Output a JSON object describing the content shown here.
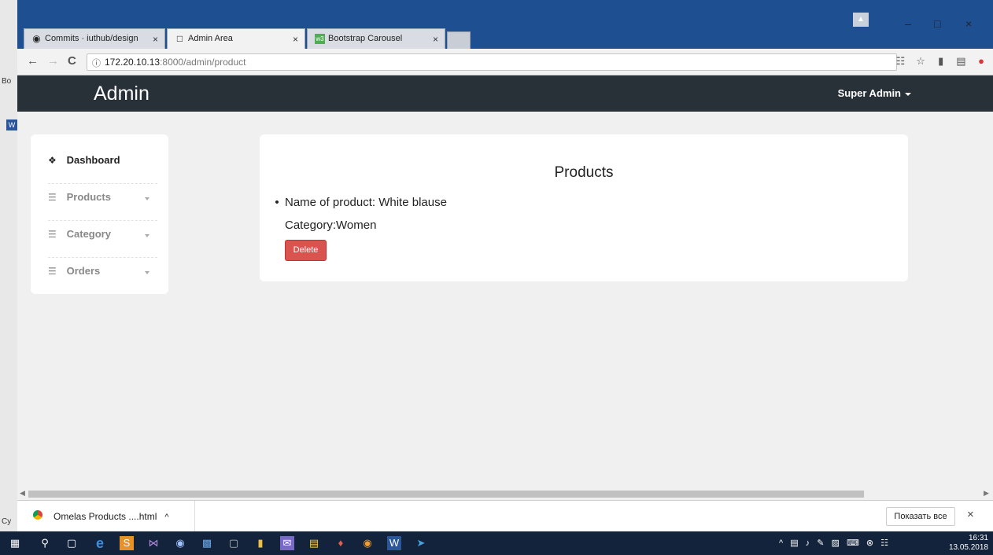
{
  "browser": {
    "tabs": [
      {
        "title": "Commits · iuthub/design",
        "icon": "github-icon"
      },
      {
        "title": "Admin Area",
        "icon": "page-icon"
      },
      {
        "title": "Bootstrap Carousel",
        "icon": "w3-icon"
      }
    ],
    "url_host": "172.20.10.13",
    "url_path": ":8000/admin/product"
  },
  "app": {
    "brand": "Admin",
    "user_menu": "Super Admin"
  },
  "sidebar": {
    "items": [
      {
        "label": "Dashboard",
        "icon": "home-icon"
      },
      {
        "label": "Products",
        "icon": "list-icon"
      },
      {
        "label": "Category",
        "icon": "list-icon"
      },
      {
        "label": "Orders",
        "icon": "list-icon"
      }
    ]
  },
  "main": {
    "title": "Products",
    "product_name_line": "Name of product: White blause",
    "category_line": "Category:Women",
    "delete_label": "Delete"
  },
  "downloads": {
    "file": "Omelas Products ....html",
    "show_all": "Показать все"
  },
  "taskbar": {
    "time": "16:31",
    "date": "13.05.2018"
  },
  "colors": {
    "navbar": "#283038",
    "danger": "#d9534f",
    "background": "#f0f0f0"
  }
}
